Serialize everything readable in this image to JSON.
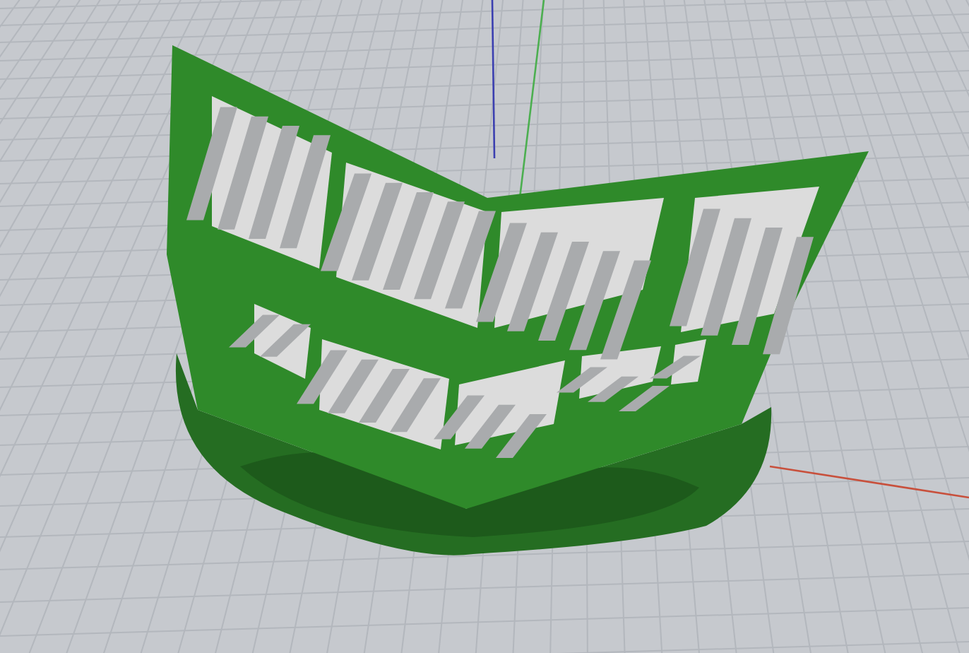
{
  "viewport": {
    "axes": [
      {
        "kind": "x",
        "color": "#c8503c"
      },
      {
        "kind": "y",
        "color": "#4caf50"
      },
      {
        "kind": "z",
        "color": "#3b3fb0"
      }
    ]
  }
}
